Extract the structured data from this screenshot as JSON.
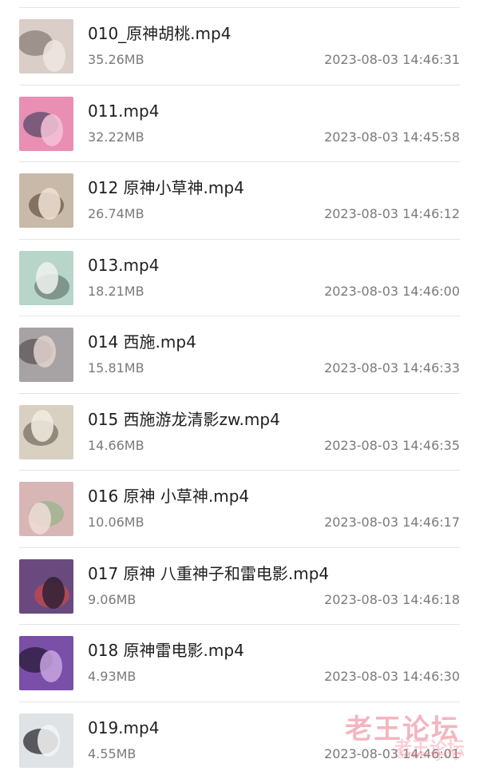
{
  "files": [
    {
      "name": "010_原神胡桃.mp4",
      "size": "35.26MB",
      "date": "2023-08-03 14:46:31",
      "thumb_colors": [
        "#d9cfc8",
        "#8a7f78",
        "#efe6e2"
      ]
    },
    {
      "name": "011.mp4",
      "size": "32.22MB",
      "date": "2023-08-03 14:45:58",
      "thumb_colors": [
        "#e88fb3",
        "#5a4a6a",
        "#f2c4d8"
      ]
    },
    {
      "name": "012 原神小草神.mp4",
      "size": "26.74MB",
      "date": "2023-08-03 14:46:12",
      "thumb_colors": [
        "#c9b9a8",
        "#6e5a48",
        "#efe3d6"
      ]
    },
    {
      "name": "013.mp4",
      "size": "18.21MB",
      "date": "2023-08-03 14:46:00",
      "thumb_colors": [
        "#b7d6c9",
        "#6d7f7a",
        "#eef2ee"
      ]
    },
    {
      "name": "014 西施.mp4",
      "size": "15.81MB",
      "date": "2023-08-03 14:46:33",
      "thumb_colors": [
        "#a7a2a3",
        "#5c5658",
        "#e2d2cc"
      ]
    },
    {
      "name": "015 西施游龙清影zw.mp4",
      "size": "14.66MB",
      "date": "2023-08-03 14:46:35",
      "thumb_colors": [
        "#d8d0c0",
        "#7b7265",
        "#f2ece0"
      ]
    },
    {
      "name": "016 原神 小草神.mp4",
      "size": "10.06MB",
      "date": "2023-08-03 14:46:17",
      "thumb_colors": [
        "#d8b6b6",
        "#9ab48a",
        "#f1dcd8"
      ]
    },
    {
      "name": "017 原神 八重神子和雷电影.mp4",
      "size": "9.06MB",
      "date": "2023-08-03 14:46:18",
      "thumb_colors": [
        "#6a4a7e",
        "#c7474e",
        "#2e2234"
      ]
    },
    {
      "name": "018 原神雷电影.mp4",
      "size": "4.93MB",
      "date": "2023-08-03 14:46:30",
      "thumb_colors": [
        "#7a4fa8",
        "#2a1a3a",
        "#c7a4e0"
      ]
    },
    {
      "name": "019.mp4",
      "size": "4.55MB",
      "date": "2023-08-03 14:46:01",
      "thumb_colors": [
        "#dfe3e6",
        "#2b2b30",
        "#f5f5f5"
      ]
    }
  ],
  "watermark": {
    "main": "老王论坛",
    "sub": "老王论坛",
    "url": "laowang.vip"
  }
}
